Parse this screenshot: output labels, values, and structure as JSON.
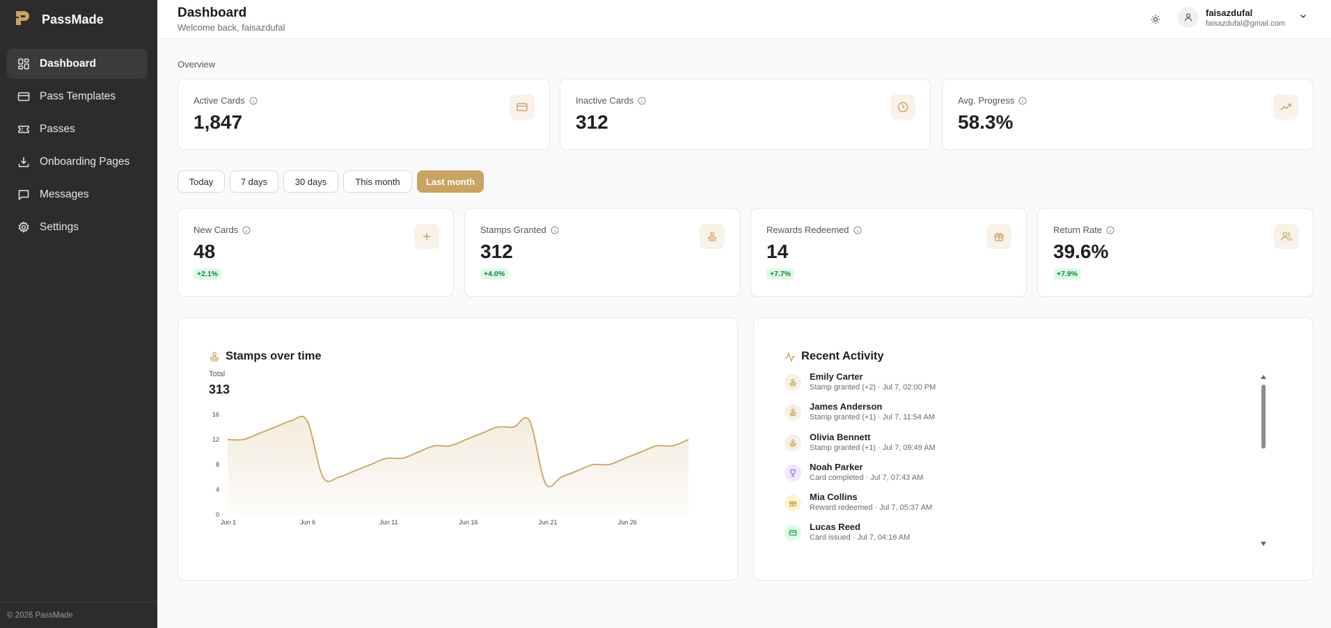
{
  "brand": {
    "name": "PassMade"
  },
  "sidebar": {
    "items": [
      {
        "label": "Dashboard",
        "icon": "dashboard-icon",
        "active": true
      },
      {
        "label": "Pass Templates",
        "icon": "card-icon"
      },
      {
        "label": "Passes",
        "icon": "ticket-icon"
      },
      {
        "label": "Onboarding Pages",
        "icon": "download-icon"
      },
      {
        "label": "Messages",
        "icon": "message-icon"
      },
      {
        "label": "Settings",
        "icon": "gear-icon"
      }
    ],
    "footer": "© 2026 PassMade"
  },
  "header": {
    "title": "Dashboard",
    "subtitle": "Welcome back, faisazdufal",
    "user": {
      "name": "faisazdufal",
      "email": "faisazdufal@gmail.com"
    }
  },
  "overview": {
    "label": "Overview",
    "cards": [
      {
        "title": "Active Cards",
        "value": "1,847",
        "icon": "credit-card-icon"
      },
      {
        "title": "Inactive Cards",
        "value": "312",
        "icon": "clock-icon"
      },
      {
        "title": "Avg. Progress",
        "value": "58.3%",
        "icon": "trending-up-icon"
      }
    ]
  },
  "ranges": [
    "Today",
    "7 days",
    "30 days",
    "This month",
    "Last month"
  ],
  "active_range": "Last month",
  "metrics": [
    {
      "title": "New Cards",
      "value": "48",
      "change": "+2.1%",
      "icon": "plus-icon"
    },
    {
      "title": "Stamps Granted",
      "value": "312",
      "change": "+4.0%",
      "icon": "stamp-icon"
    },
    {
      "title": "Rewards Redeemed",
      "value": "14",
      "change": "+7.7%",
      "icon": "gift-icon"
    },
    {
      "title": "Return Rate",
      "value": "39.6%",
      "change": "+7.9%",
      "icon": "users-icon"
    }
  ],
  "stamps_panel": {
    "title": "Stamps over time",
    "total_label": "Total",
    "total_value": "313"
  },
  "chart_data": {
    "type": "area",
    "title": "Stamps over time",
    "x": [
      "Jun 1",
      "Jun 2",
      "Jun 3",
      "Jun 4",
      "Jun 5",
      "Jun 6",
      "Jun 7",
      "Jun 8",
      "Jun 9",
      "Jun 10",
      "Jun 11",
      "Jun 12",
      "Jun 13",
      "Jun 14",
      "Jun 15",
      "Jun 16",
      "Jun 17",
      "Jun 18",
      "Jun 19",
      "Jun 20",
      "Jun 21",
      "Jun 22",
      "Jun 23",
      "Jun 24",
      "Jun 25",
      "Jun 26",
      "Jun 27",
      "Jun 28",
      "Jun 29",
      "Jun 30"
    ],
    "values": [
      12,
      12,
      13,
      14,
      15,
      15,
      6,
      6,
      7,
      8,
      9,
      9,
      10,
      11,
      11,
      12,
      13,
      14,
      14,
      15,
      5,
      6,
      7,
      8,
      8,
      9,
      10,
      11,
      11,
      12
    ],
    "xticks": [
      "Jun 1",
      "Jun 6",
      "Jun 11",
      "Jun 16",
      "Jun 21",
      "Jun 26"
    ],
    "yticks": [
      0,
      4,
      8,
      12,
      16
    ],
    "ylim": [
      0,
      16
    ],
    "xlabel": "",
    "ylabel": "",
    "color": "#c9a35f",
    "grid": false
  },
  "activity": {
    "title": "Recent Activity",
    "items": [
      {
        "name": "Emily Carter",
        "meta": "Stamp granted (+2) · Jul 7, 02:00 PM",
        "kind": "stamp",
        "bg": "#f7f0e3",
        "fg": "#c9a35f"
      },
      {
        "name": "James Anderson",
        "meta": "Stamp granted (+1) · Jul 7, 11:54 AM",
        "kind": "stamp",
        "bg": "#f7f0e3",
        "fg": "#c9a35f"
      },
      {
        "name": "Olivia Bennett",
        "meta": "Stamp granted (+1) · Jul 7, 09:49 AM",
        "kind": "stamp",
        "bg": "#f7f0e3",
        "fg": "#c9a35f"
      },
      {
        "name": "Noah Parker",
        "meta": "Card completed · Jul 7, 07:43 AM",
        "kind": "trophy",
        "bg": "#f0e8fb",
        "fg": "#8b5cf6"
      },
      {
        "name": "Mia Collins",
        "meta": "Reward redeemed · Jul 7, 05:37 AM",
        "kind": "gift",
        "bg": "#fdf3d6",
        "fg": "#d49a16"
      },
      {
        "name": "Lucas Reed",
        "meta": "Card issued · Jul 7, 04:16 AM",
        "kind": "card",
        "bg": "#dcfce7",
        "fg": "#16a34a"
      }
    ]
  }
}
